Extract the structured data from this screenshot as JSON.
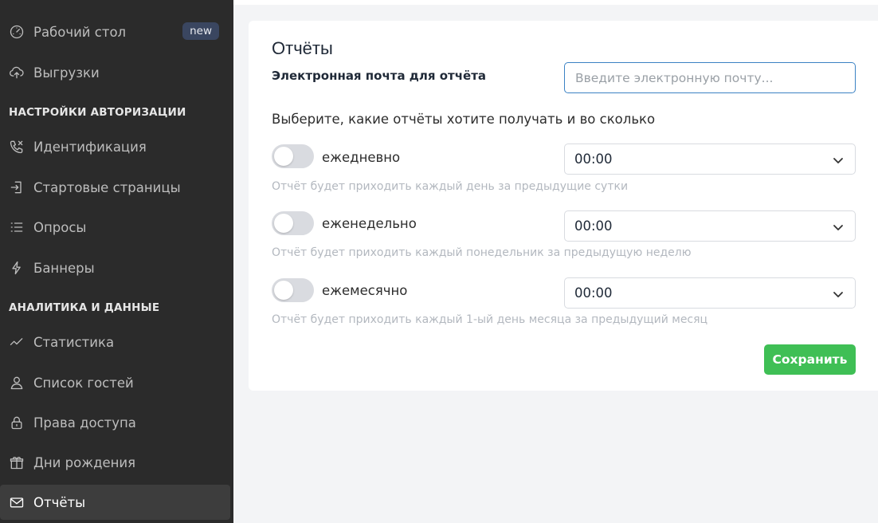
{
  "sidebar": {
    "items": [
      {
        "label": "Рабочий стол",
        "icon": "speedometer-icon",
        "badge": "new"
      },
      {
        "label": "Выгрузки",
        "icon": "cloud-upload-icon"
      },
      {
        "label": "Идентификация",
        "icon": "phone-icon"
      },
      {
        "label": "Стартовые страницы",
        "icon": "sign-in-icon"
      },
      {
        "label": "Опросы",
        "icon": "list-icon"
      },
      {
        "label": "Баннеры",
        "icon": "lightning-icon"
      },
      {
        "label": "Статистика",
        "icon": "line-chart-icon"
      },
      {
        "label": "Список гостей",
        "icon": "user-icon"
      },
      {
        "label": "Права доступа",
        "icon": "lock-icon"
      },
      {
        "label": "Дни рождения",
        "icon": "gift-icon"
      },
      {
        "label": "Отчёты",
        "icon": "envelope-icon",
        "active": true
      }
    ],
    "sections": {
      "auth": "НАСТРОЙКИ АВТОРИЗАЦИИ",
      "analytics": "АНАЛИТИКА И ДАННЫЕ"
    }
  },
  "main": {
    "title": "Отчёты",
    "email_label": "Электронная почта для отчёта",
    "email_value": "",
    "email_placeholder": "Введите электронную почту...",
    "subtitle": "Выберите, какие отчёты хотите получать и во сколько",
    "reports": [
      {
        "label": "ежедневно",
        "time": "00:00",
        "enabled": false,
        "hint": "Отчёт будет приходить каждый день за предыдущие сутки"
      },
      {
        "label": "еженедельно",
        "time": "00:00",
        "enabled": false,
        "hint": "Отчёт будет приходить каждый понедельник за предыдущую неделю"
      },
      {
        "label": "ежемесячно",
        "time": "00:00",
        "enabled": false,
        "hint": "Отчёт будет приходить каждый 1-ый день месяца за предыдущий месяц"
      }
    ],
    "save_label": "Сохранить"
  },
  "colors": {
    "sidebar_bg": "#2b2b2b",
    "accent_blue": "#3b82c4",
    "save_green": "#3fbf55",
    "badge_bg": "#3a4660"
  }
}
